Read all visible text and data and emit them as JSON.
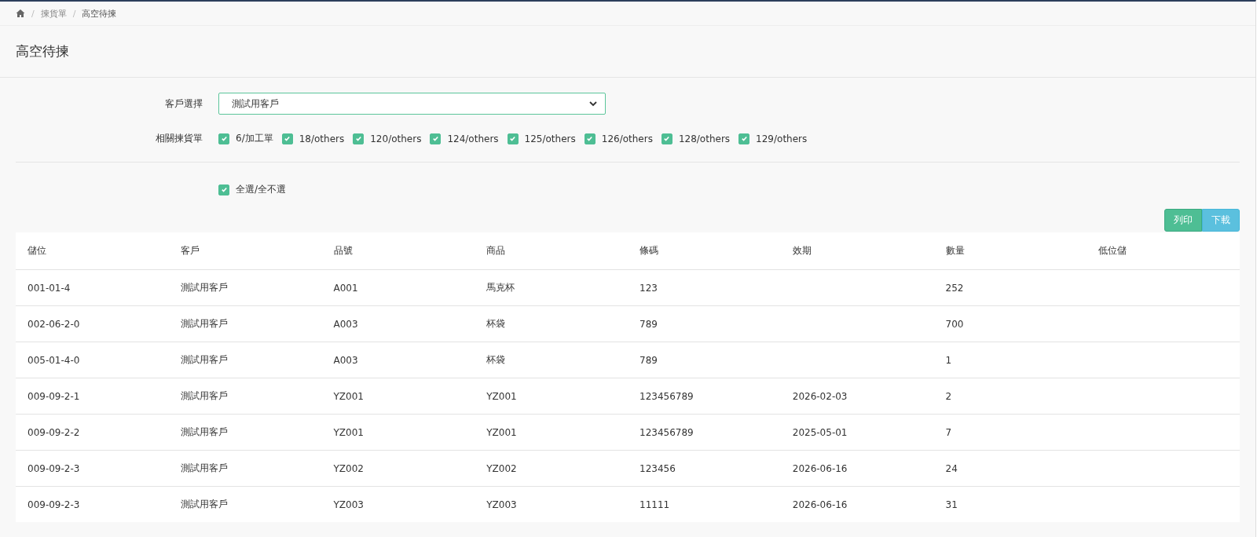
{
  "breadcrumb": {
    "items": [
      {
        "separator": "/",
        "label": "揀貨單"
      },
      {
        "separator": "/",
        "label": "高空待揀"
      }
    ]
  },
  "page_title": "高空待揀",
  "customer_select": {
    "label": "客戶選擇",
    "value": "測試用客戶"
  },
  "pick_lists": {
    "label": "相關揀貨單",
    "items": [
      {
        "label": "6/加工單",
        "checked": true
      },
      {
        "label": "18/others",
        "checked": true
      },
      {
        "label": "120/others",
        "checked": true
      },
      {
        "label": "124/others",
        "checked": true
      },
      {
        "label": "125/others",
        "checked": true
      },
      {
        "label": "126/others",
        "checked": true
      },
      {
        "label": "128/others",
        "checked": true
      },
      {
        "label": "129/others",
        "checked": true
      }
    ]
  },
  "select_all": {
    "label": "全選/全不選",
    "checked": true
  },
  "buttons": [
    {
      "label": "列印",
      "kind": "print"
    },
    {
      "label": "下載",
      "kind": "download"
    }
  ],
  "table": {
    "columns": [
      "儲位",
      "客戶",
      "品號",
      "商品",
      "條碼",
      "效期",
      "數量",
      "低位儲"
    ],
    "rows": [
      [
        "001-01-4",
        "測試用客戶",
        "A001",
        "馬克杯",
        "123",
        "",
        "252",
        ""
      ],
      [
        "002-06-2-0",
        "測試用客戶",
        "A003",
        "杯袋",
        "789",
        "",
        "700",
        ""
      ],
      [
        "005-01-4-0",
        "測試用客戶",
        "A003",
        "杯袋",
        "789",
        "",
        "1",
        ""
      ],
      [
        "009-09-2-1",
        "測試用客戶",
        "YZ001",
        "YZ001",
        "123456789",
        "2026-02-03",
        "2",
        ""
      ],
      [
        "009-09-2-2",
        "測試用客戶",
        "YZ001",
        "YZ001",
        "123456789",
        "2025-05-01",
        "7",
        ""
      ],
      [
        "009-09-2-3",
        "測試用客戶",
        "YZ002",
        "YZ002",
        "123456",
        "2026-06-16",
        "24",
        ""
      ],
      [
        "009-09-2-3",
        "測試用客戶",
        "YZ003",
        "YZ003",
        "11111",
        "2026-06-16",
        "31",
        ""
      ]
    ]
  }
}
